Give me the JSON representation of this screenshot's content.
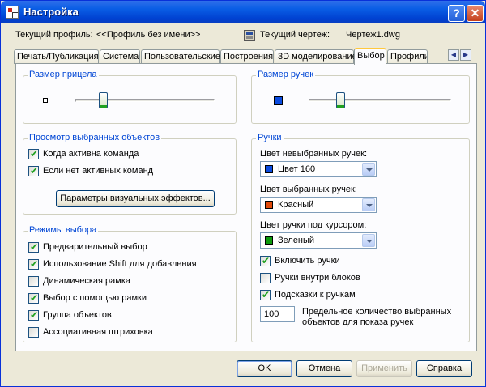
{
  "window": {
    "title": "Настройка"
  },
  "info": {
    "profile_label": "Текущий профиль:",
    "profile_value": "<<Профиль без имени>>",
    "drawing_label": "Текущий чертеж:",
    "drawing_value": "Чертеж1.dwg"
  },
  "tabs": [
    {
      "label": "Печать/Публикация"
    },
    {
      "label": "Система"
    },
    {
      "label": "Пользовательские"
    },
    {
      "label": "Построения"
    },
    {
      "label": "3D моделирование"
    },
    {
      "label": "Выбор",
      "active": true
    },
    {
      "label": "Профили"
    }
  ],
  "pickbox": {
    "title": "Размер прицела",
    "value_percent": 20
  },
  "grip_size": {
    "title": "Размер ручек",
    "value_percent": 22
  },
  "preview": {
    "title": "Просмотр выбранных объектов",
    "options": [
      {
        "label": "Когда активна команда",
        "checked": true
      },
      {
        "label": "Если нет активных команд",
        "checked": true
      }
    ],
    "effects_button": "Параметры визуальных эффектов..."
  },
  "modes": {
    "title": "Режимы выбора",
    "options": [
      {
        "label": "Предварительный выбор",
        "checked": true
      },
      {
        "label": "Использование Shift для добавления",
        "checked": true
      },
      {
        "label": "Динамическая рамка",
        "checked": false
      },
      {
        "label": "Выбор с помощью рамки",
        "checked": true
      },
      {
        "label": "Группа объектов",
        "checked": true
      },
      {
        "label": "Ассоциативная штриховка",
        "checked": false
      }
    ]
  },
  "grips": {
    "title": "Ручки",
    "unselected": {
      "label": "Цвет невыбранных ручек:",
      "value": "Цвет 160",
      "color": "#0a4be0"
    },
    "selected": {
      "label": "Цвет выбранных ручек:",
      "value": "Красный",
      "color": "#e04a0a"
    },
    "hover": {
      "label": "Цвет ручки под курсором:",
      "value": "Зеленый",
      "color": "#0c9a0c"
    },
    "options": [
      {
        "label": "Включить ручки",
        "checked": true
      },
      {
        "label": "Ручки внутри блоков",
        "checked": false
      },
      {
        "label": "Подсказки к ручкам",
        "checked": true
      }
    ],
    "limit_value": "100",
    "limit_label_line1": "Предельное количество выбранных",
    "limit_label_line2": "объектов для показа ручек"
  },
  "buttons": {
    "ok": "OK",
    "cancel": "Отмена",
    "apply": "Применить",
    "help": "Справка"
  },
  "icons": {
    "title": "autocad-app-icon",
    "drawing": "drawing-file-icon"
  },
  "colors": {
    "titlebar": "#0a5ee5",
    "group_title": "#0046d5",
    "check": "#21a121"
  }
}
